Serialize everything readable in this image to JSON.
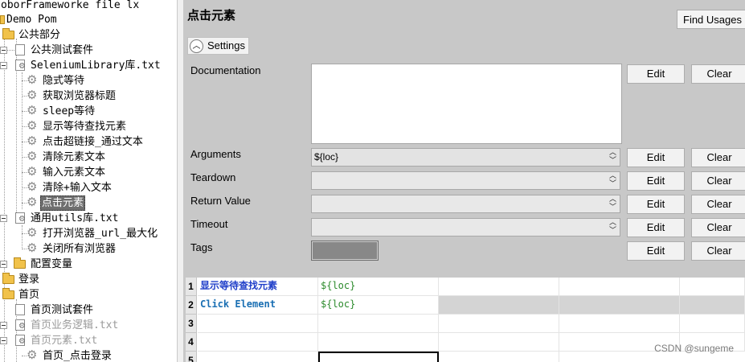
{
  "tree": {
    "project_title": "oborFrameworke file lx",
    "root": "Demo Pom",
    "items": [
      {
        "label": "公共部分"
      },
      {
        "label": "公共测试套件"
      },
      {
        "label": "SeleniumLibrary库.txt"
      },
      {
        "label": "隐式等待"
      },
      {
        "label": "获取浏览器标题"
      },
      {
        "label": "sleep等待"
      },
      {
        "label": "显示等待查找元素"
      },
      {
        "label": "点击超链接_通过文本"
      },
      {
        "label": "清除元素文本"
      },
      {
        "label": "输入元素文本"
      },
      {
        "label": "清除+输入文本"
      },
      {
        "label": "点击元素"
      },
      {
        "label": "通用utils库.txt"
      },
      {
        "label": "打开浏览器_url_最大化"
      },
      {
        "label": "关闭所有浏览器"
      },
      {
        "label": "配置变量"
      },
      {
        "label": "登录"
      },
      {
        "label": "首页"
      },
      {
        "label": "首页测试套件"
      },
      {
        "label": "首页业务逻辑.txt"
      },
      {
        "label": "首页元素.txt"
      },
      {
        "label": "首页_点击登录"
      }
    ]
  },
  "editor": {
    "title": "点击元素",
    "find_usages": "Find Usages",
    "settings_label": "Settings",
    "fields": {
      "documentation": {
        "label": "Documentation",
        "value": ""
      },
      "arguments": {
        "label": "Arguments",
        "value": "${loc}"
      },
      "teardown": {
        "label": "Teardown",
        "value": ""
      },
      "return_value": {
        "label": "Return Value",
        "value": ""
      },
      "timeout": {
        "label": "Timeout",
        "value": ""
      },
      "tags": {
        "label": "Tags"
      }
    },
    "edit_label": "Edit",
    "clear_label": "Clear",
    "grid": {
      "row_numbers": [
        "1",
        "2",
        "3",
        "4",
        "5"
      ],
      "rows": [
        {
          "keyword": "显示等待查找元素",
          "arg": "${loc}"
        },
        {
          "keyword": "Click Element",
          "arg": "${loc}"
        }
      ]
    }
  },
  "watermark": "CSDN @sungeme",
  "colors": {
    "panel_bg": "#c8c8c8",
    "selected_tree_item": "#6f6f6f",
    "keyword_text": "#1f3ec9",
    "arg_text": "#2b8a2b"
  }
}
